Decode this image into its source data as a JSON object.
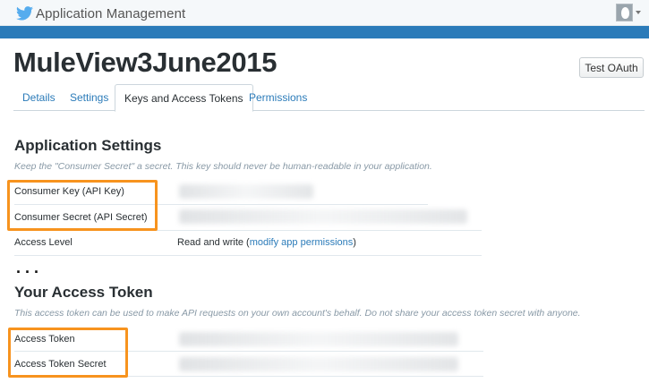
{
  "header": {
    "title": "Application Management",
    "logo_icon": "twitter-bird-icon",
    "brand_color": "#55acee",
    "avatar_icon": "default-egg-avatar-icon"
  },
  "app": {
    "name": "MuleView3June2015",
    "test_oauth_label": "Test OAuth"
  },
  "tabs": [
    {
      "label": "Details",
      "active": false
    },
    {
      "label": "Settings",
      "active": false
    },
    {
      "label": "Keys and Access Tokens",
      "active": true
    },
    {
      "label": "Permissions",
      "active": false
    }
  ],
  "app_settings": {
    "title": "Application Settings",
    "description": "Keep the \"Consumer Secret\" a secret. This key should never be human-readable in your application.",
    "rows": [
      {
        "label": "Consumer Key (API Key)",
        "value_redacted": true
      },
      {
        "label": "Consumer Secret (API Secret)",
        "value_redacted": true
      },
      {
        "label": "Access Level",
        "value_prefix": "Read and write (",
        "value_link": "modify app permissions",
        "value_suffix": ")"
      }
    ]
  },
  "ellipsis": "...",
  "access_token": {
    "title": "Your Access Token",
    "description": "This access token can be used to make API requests on your own account's behalf. Do not share your access token secret with anyone.",
    "rows": [
      {
        "label": "Access Token",
        "value_redacted": true
      },
      {
        "label": "Access Token Secret",
        "value_redacted": true
      }
    ]
  },
  "colors": {
    "accent_blue": "#2b7bb9",
    "highlight_orange": "#f7931e"
  }
}
